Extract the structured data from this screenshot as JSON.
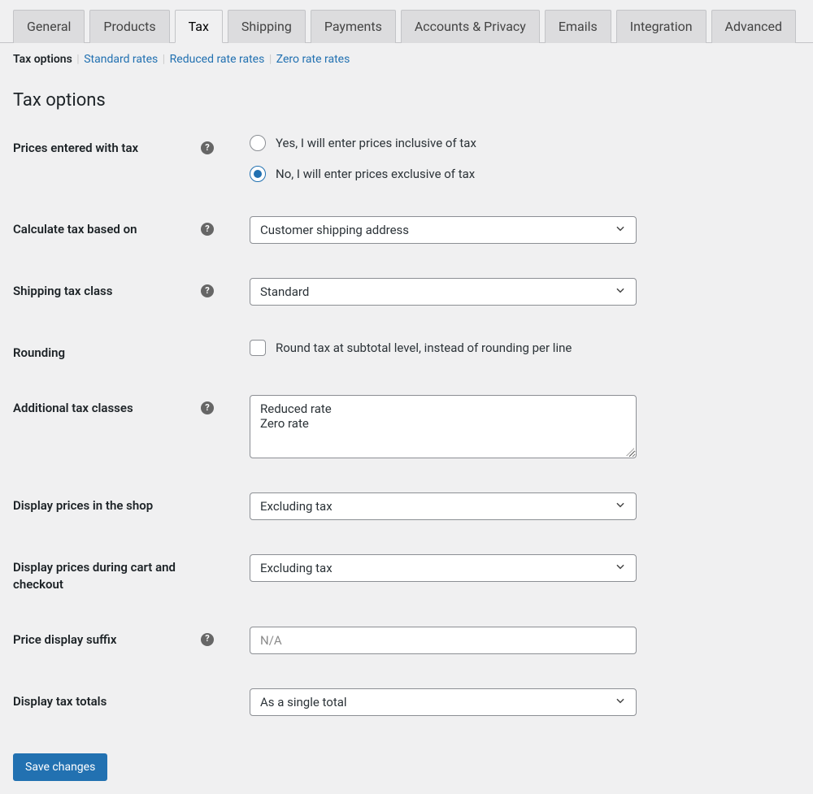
{
  "main_tabs": {
    "general": "General",
    "products": "Products",
    "tax": "Tax",
    "shipping": "Shipping",
    "payments": "Payments",
    "accounts": "Accounts & Privacy",
    "emails": "Emails",
    "integration": "Integration",
    "advanced": "Advanced"
  },
  "sub_tabs": {
    "tax_options": "Tax options",
    "standard_rates": "Standard rates",
    "reduced_rates": "Reduced rate rates",
    "zero_rates": "Zero rate rates"
  },
  "page_title": "Tax options",
  "labels": {
    "prices_entered": "Prices entered with tax",
    "calc_based_on": "Calculate tax based on",
    "shipping_tax_class": "Shipping tax class",
    "rounding": "Rounding",
    "additional_classes": "Additional tax classes",
    "display_shop": "Display prices in the shop",
    "display_cart": "Display prices during cart and checkout",
    "price_suffix": "Price display suffix",
    "display_totals": "Display tax totals"
  },
  "options": {
    "price_yes": "Yes, I will enter prices inclusive of tax",
    "price_no": "No, I will enter prices exclusive of tax",
    "rounding_label": "Round tax at subtotal level, instead of rounding per line"
  },
  "values": {
    "calc_based_on": "Customer shipping address",
    "shipping_tax_class": "Standard",
    "additional_classes": "Reduced rate\nZero rate",
    "display_shop": "Excluding tax",
    "display_cart": "Excluding tax",
    "price_suffix_placeholder": "N/A",
    "display_totals": "As a single total"
  },
  "save_button": "Save changes",
  "colors": {
    "accent": "#2271b1"
  }
}
